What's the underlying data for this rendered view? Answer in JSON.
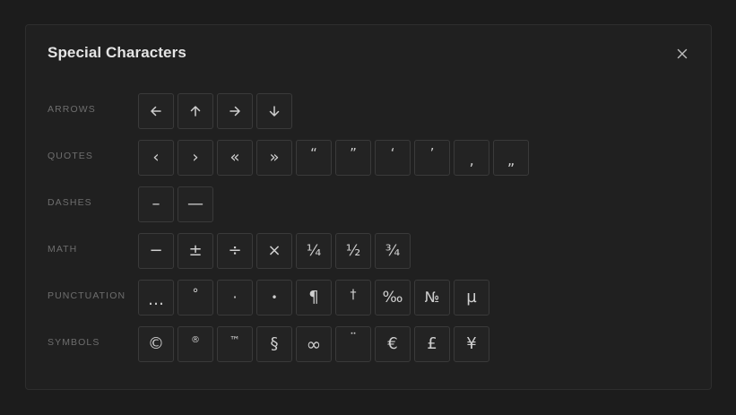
{
  "dialog": {
    "title": "Special Characters",
    "close_icon": "close-icon"
  },
  "categories": [
    {
      "label": "ARROWS",
      "chars": [
        {
          "char": "←",
          "name": "left-arrow",
          "icon": "arrow-left-icon"
        },
        {
          "char": "↑",
          "name": "up-arrow",
          "icon": "arrow-up-icon"
        },
        {
          "char": "→",
          "name": "right-arrow",
          "icon": "arrow-right-icon"
        },
        {
          "char": "↓",
          "name": "down-arrow",
          "icon": "arrow-down-icon"
        }
      ]
    },
    {
      "label": "QUOTES",
      "chars": [
        {
          "char": "‹",
          "name": "single-left-angle-quote"
        },
        {
          "char": "›",
          "name": "single-right-angle-quote"
        },
        {
          "char": "«",
          "name": "double-left-angle-quote"
        },
        {
          "char": "»",
          "name": "double-right-angle-quote"
        },
        {
          "char": "“",
          "name": "left-double-quote"
        },
        {
          "char": "”",
          "name": "right-double-quote"
        },
        {
          "char": "‘",
          "name": "left-single-quote"
        },
        {
          "char": "’",
          "name": "right-single-quote"
        },
        {
          "char": "‚",
          "name": "single-low-quote"
        },
        {
          "char": "„",
          "name": "double-low-quote"
        }
      ]
    },
    {
      "label": "DASHES",
      "chars": [
        {
          "char": "–",
          "name": "en-dash"
        },
        {
          "char": "—",
          "name": "em-dash"
        }
      ]
    },
    {
      "label": "MATH",
      "chars": [
        {
          "char": "−",
          "name": "minus"
        },
        {
          "char": "±",
          "name": "plus-minus"
        },
        {
          "char": "÷",
          "name": "division"
        },
        {
          "char": "×",
          "name": "multiplication"
        },
        {
          "char": "¼",
          "name": "one-quarter"
        },
        {
          "char": "½",
          "name": "one-half"
        },
        {
          "char": "¾",
          "name": "three-quarters"
        }
      ]
    },
    {
      "label": "PUNCTUATION",
      "chars": [
        {
          "char": "…",
          "name": "ellipsis"
        },
        {
          "char": "°",
          "name": "degree"
        },
        {
          "char": "·",
          "name": "middle-dot"
        },
        {
          "char": "•",
          "name": "bullet"
        },
        {
          "char": "¶",
          "name": "pilcrow"
        },
        {
          "char": "†",
          "name": "dagger"
        },
        {
          "char": "‰",
          "name": "per-mille"
        },
        {
          "char": "№",
          "name": "numero"
        },
        {
          "char": "µ",
          "name": "micro"
        }
      ]
    },
    {
      "label": "SYMBOLS",
      "chars": [
        {
          "char": "©",
          "name": "copyright"
        },
        {
          "char": "®",
          "name": "registered"
        },
        {
          "char": "™",
          "name": "trademark"
        },
        {
          "char": "§",
          "name": "section"
        },
        {
          "char": "∞",
          "name": "infinity"
        },
        {
          "char": "¨",
          "name": "diaeresis"
        },
        {
          "char": "€",
          "name": "euro"
        },
        {
          "char": "£",
          "name": "pound"
        },
        {
          "char": "¥",
          "name": "yen"
        }
      ]
    }
  ]
}
